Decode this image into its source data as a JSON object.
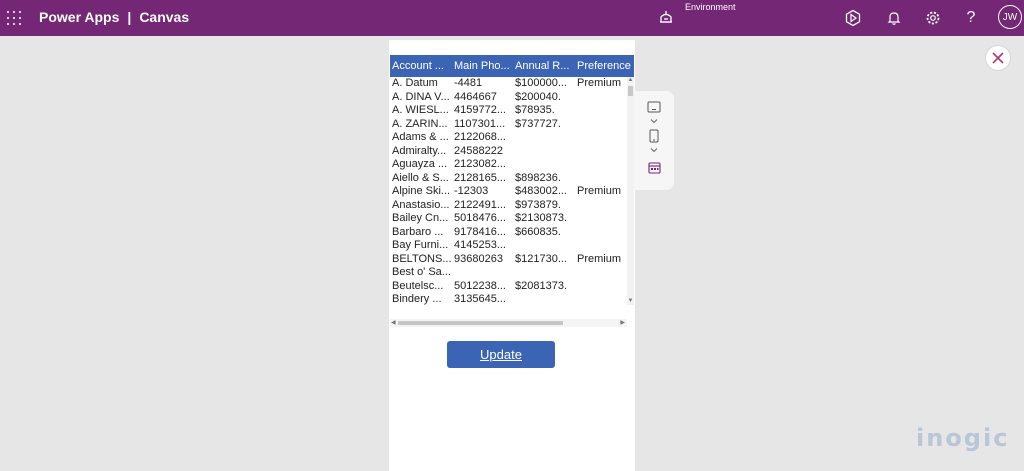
{
  "topbar": {
    "app_name": "Power Apps",
    "separator": "|",
    "app_mode": "Canvas",
    "environment_label": "Environment",
    "user_initials": "JW",
    "icons": [
      "waffle-icon",
      "environment-icon",
      "copilot-icon",
      "bell-icon",
      "gear-icon",
      "help-icon"
    ]
  },
  "grid": {
    "columns": [
      "Account ...",
      "Main Pho...",
      "Annual R...",
      "Preference"
    ],
    "rows": [
      [
        "A. Datum",
        "-4481",
        "$100000...",
        "Premium"
      ],
      [
        "A. DINA V...",
        "4464667",
        "$200040.",
        ""
      ],
      [
        "A. WIESL...",
        "4159772...",
        "$78935.",
        ""
      ],
      [
        "A. ZARIN...",
        "1107301...",
        "$737727.",
        ""
      ],
      [
        "Adams & ...",
        "2122068...",
        "",
        ""
      ],
      [
        "Admiralty...",
        "24588222",
        "",
        ""
      ],
      [
        "Aguayza ...",
        "2123082...",
        "",
        ""
      ],
      [
        "Aiello & S...",
        "2128165...",
        "$898236.",
        ""
      ],
      [
        "Alpine Ski...",
        "-12303",
        "$483002...",
        "Premium"
      ],
      [
        "Anastasio...",
        "2122491...",
        "$973879.",
        ""
      ],
      [
        "Bailey Cn...",
        "5018476...",
        "$2130873.",
        ""
      ],
      [
        "Barbaro ...",
        "9178416...",
        "$660835.",
        ""
      ],
      [
        "Bay Furni...",
        "4145253...",
        "",
        ""
      ],
      [
        "BELTONS...",
        "93680263",
        "$121730...",
        "Premium"
      ],
      [
        "Best o' Sa...",
        "",
        "",
        ""
      ],
      [
        "Beutelsc...",
        "5012238...",
        "$2081373.",
        ""
      ],
      [
        "Bindery ...",
        "3135645...",
        "",
        ""
      ]
    ]
  },
  "actions": {
    "update_label": "Update"
  },
  "sidepanel": {
    "icons": [
      "tablet-layout-icon",
      "chevron-down-icon",
      "phone-layout-icon",
      "chevron-down-icon",
      "calendar-icon"
    ]
  },
  "watermark": {
    "text": "inogic"
  },
  "colors": {
    "topbar": "#742774",
    "grid_header": "#3c64b4",
    "button": "#3c64b4",
    "background": "#e6e6e6"
  }
}
